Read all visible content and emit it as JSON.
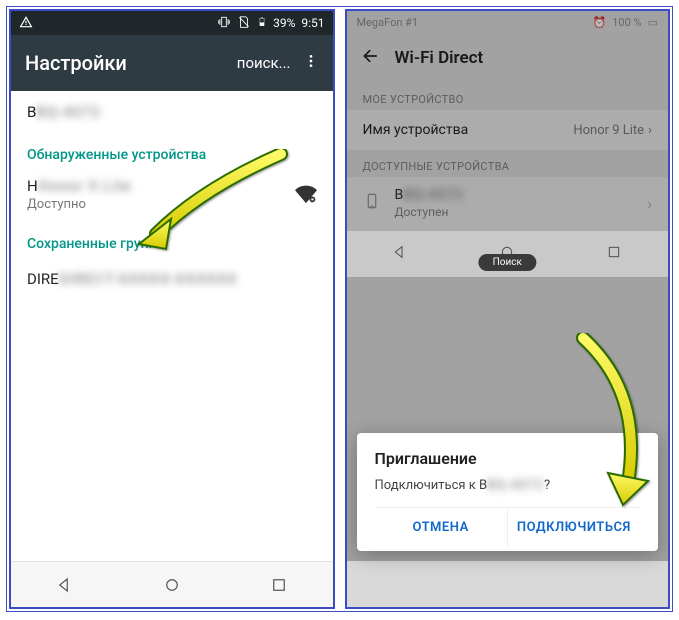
{
  "left": {
    "status": {
      "battery": "39%",
      "time": "9:51"
    },
    "header": {
      "title": "Настройки",
      "search": "поиск..."
    },
    "my_device": "BQ-4072",
    "section_discovered": "Обнаруженные устройства",
    "device": {
      "name": "Honor 9 Lite",
      "status": "Доступно"
    },
    "section_saved": "Сохраненные группы",
    "saved_group": "DIRECT-XXXXX-XXXXXX"
  },
  "right": {
    "status": {
      "carrier": "MegaFon #1",
      "battery": "100 %"
    },
    "header": {
      "title": "Wi-Fi Direct"
    },
    "section_my": "МОЕ УСТРОЙСТВО",
    "my_device": {
      "label": "Имя устройства",
      "value": "Honor 9 Lite"
    },
    "section_avail": "ДОСТУПНЫЕ УСТРОЙСТВА",
    "device": {
      "name": "BQ-4072",
      "status": "Доступен"
    },
    "dialog": {
      "title": "Приглашение",
      "message_prefix": "Подключиться к ",
      "message_device": "BQ-4072",
      "message_suffix": "?",
      "cancel": "ОТМЕНА",
      "confirm": "ПОДКЛЮЧИТЬСЯ"
    },
    "search_pill": "Поиск"
  }
}
